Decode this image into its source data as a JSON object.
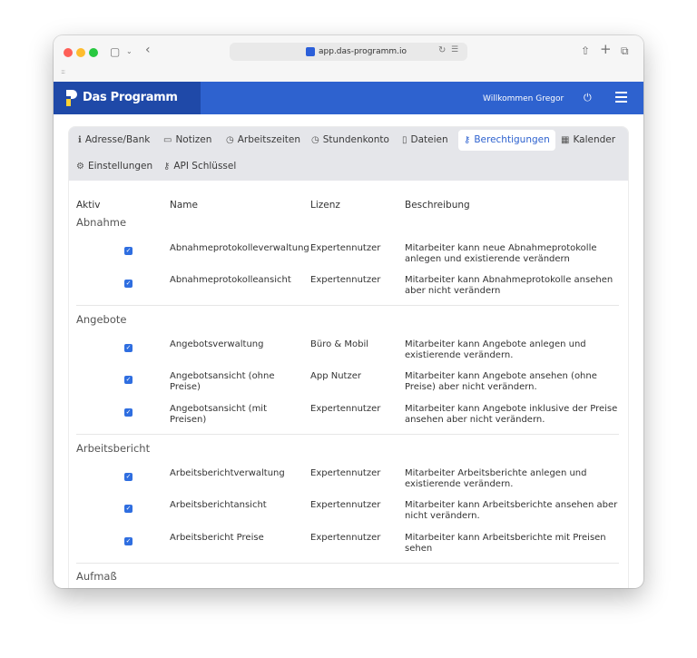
{
  "browser": {
    "url": "app.das-programm.io"
  },
  "header": {
    "app_name": "Das Programm",
    "welcome": "Willkommen Gregor",
    "brand_color": "#2e62cf"
  },
  "tabs": [
    {
      "label": "Adresse/Bank",
      "icon": "info-icon",
      "active": false
    },
    {
      "label": "Notizen",
      "icon": "note-icon",
      "active": false
    },
    {
      "label": "Arbeitszeiten",
      "icon": "clock-icon",
      "active": false
    },
    {
      "label": "Stundenkonto",
      "icon": "clock-icon",
      "active": false
    },
    {
      "label": "Dateien",
      "icon": "file-icon",
      "active": false
    },
    {
      "label": "Berechtigungen",
      "icon": "key-icon",
      "active": true
    },
    {
      "label": "Kalender",
      "icon": "calendar-icon",
      "active": false
    },
    {
      "label": "Einstellungen",
      "icon": "gear-icon",
      "active": false
    },
    {
      "label": "API Schlüssel",
      "icon": "key-icon",
      "active": false
    }
  ],
  "table": {
    "headers": [
      "Aktiv",
      "Name",
      "Lizenz",
      "Beschreibung"
    ],
    "groups": [
      {
        "title": "Abnahme",
        "rows": [
          {
            "active": true,
            "name": "Abnahmeprotokolleverwaltung",
            "license": "Expertennutzer",
            "description": "Mitarbeiter kann neue Abnahmeprotokolle anlegen und existierende verändern"
          },
          {
            "active": true,
            "name": "Abnahmeprotokolleansicht",
            "license": "Expertennutzer",
            "description": "Mitarbeiter kann Abnahmeprotokolle ansehen aber nicht verändern"
          }
        ]
      },
      {
        "title": "Angebote",
        "rows": [
          {
            "active": true,
            "name": "Angebotsverwaltung",
            "license": "Büro & Mobil",
            "description": "Mitarbeiter kann Angebote anlegen und existierende verändern."
          },
          {
            "active": true,
            "name": "Angebotsansicht (ohne Preise)",
            "license": "App Nutzer",
            "description": "Mitarbeiter kann Angebote ansehen (ohne Preise) aber nicht verändern."
          },
          {
            "active": true,
            "name": "Angebotsansicht (mit Preisen)",
            "license": "Expertennutzer",
            "description": "Mitarbeiter kann Angebote inklusive der Preise ansehen aber nicht verändern."
          }
        ]
      },
      {
        "title": "Arbeitsbericht",
        "rows": [
          {
            "active": true,
            "name": "Arbeitsberichtverwaltung",
            "license": "Expertennutzer",
            "description": "Mitarbeiter Arbeitsberichte anlegen und existierende verändern."
          },
          {
            "active": true,
            "name": "Arbeitsberichtansicht",
            "license": "Expertennutzer",
            "description": "Mitarbeiter kann Arbeitsberichte ansehen aber nicht verändern."
          },
          {
            "active": true,
            "name": "Arbeitsbericht Preise",
            "license": "Expertennutzer",
            "description": "Mitarbeiter kann Arbeitsberichte mit Preisen sehen"
          }
        ]
      },
      {
        "title": "Aufmaß",
        "rows": []
      }
    ]
  }
}
